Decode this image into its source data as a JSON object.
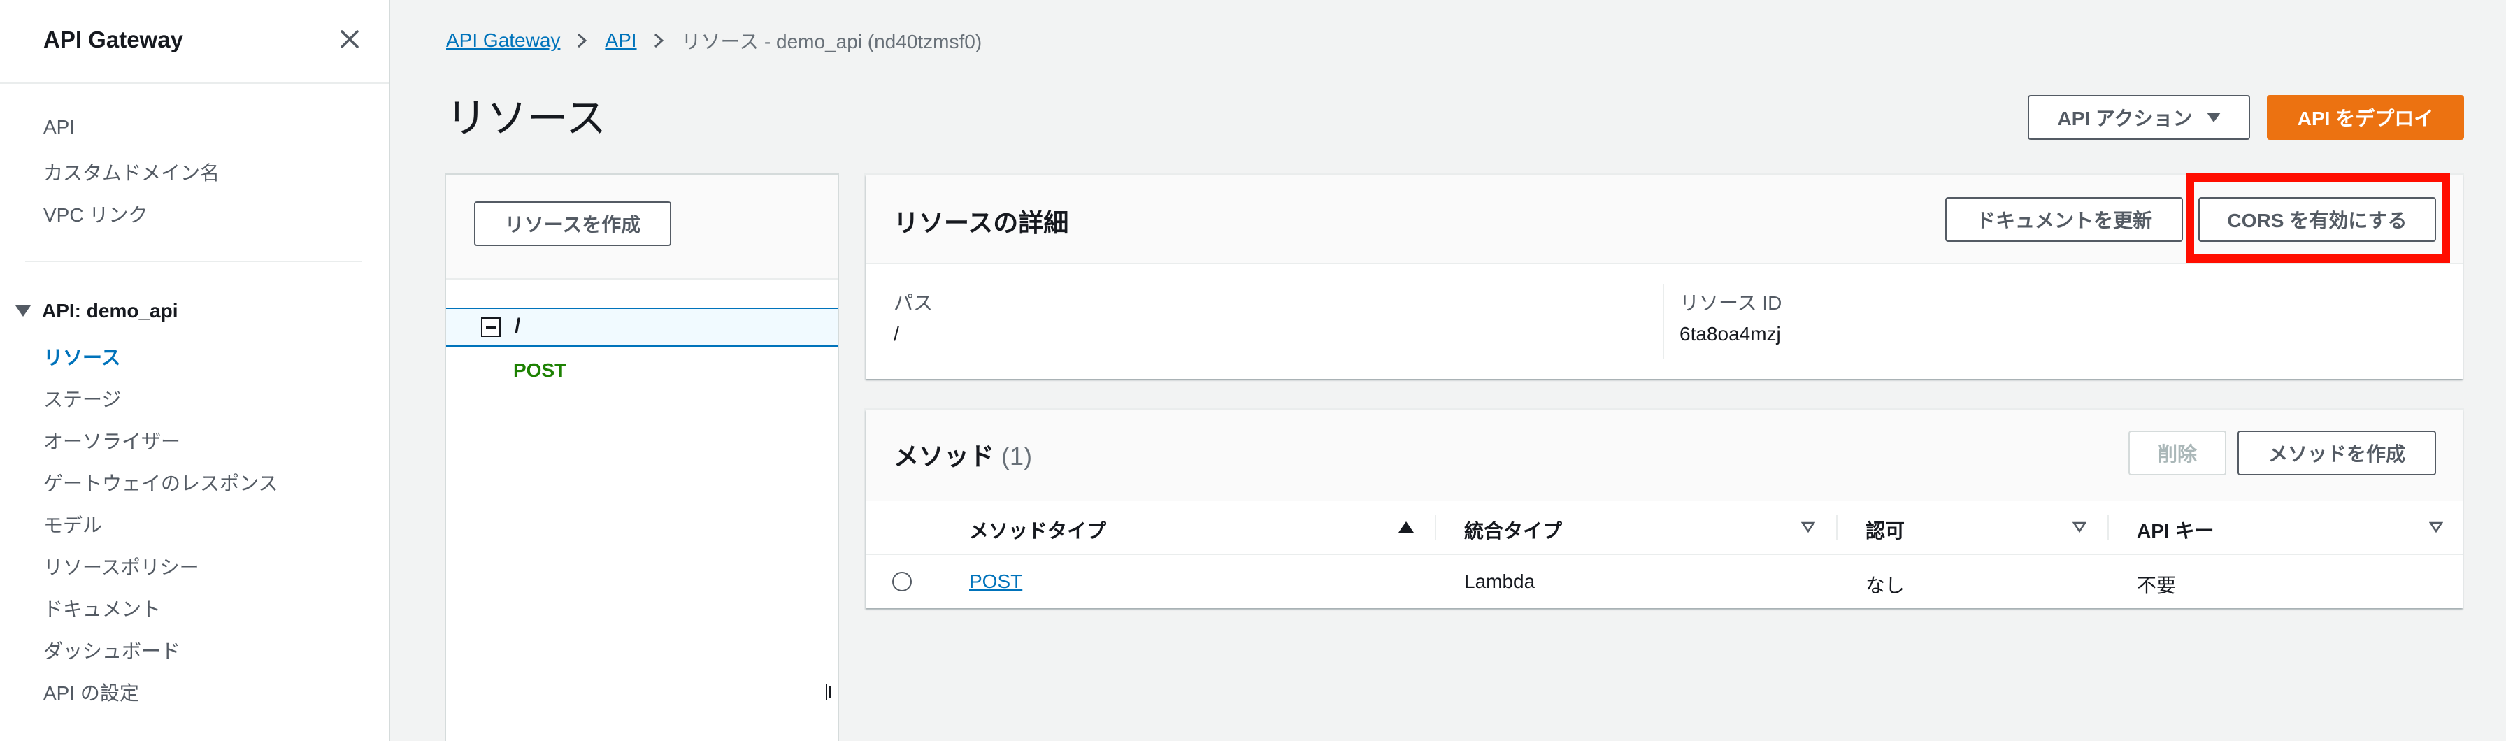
{
  "sidebar": {
    "title": "API Gateway",
    "top_links": [
      "API",
      "カスタムドメイン名",
      "VPC リンク"
    ],
    "section_title": "API: demo_api",
    "section_links": [
      "リソース",
      "ステージ",
      "オーソライザー",
      "ゲートウェイのレスポンス",
      "モデル",
      "リソースポリシー",
      "ドキュメント",
      "ダッシュボード",
      "API の設定"
    ],
    "active_link": "リソース"
  },
  "breadcrumb": {
    "items": [
      "API Gateway",
      "API"
    ],
    "current": "リソース - demo_api (nd40tzmsf0)"
  },
  "page": {
    "title": "リソース"
  },
  "actions": {
    "api_actions": "API アクション",
    "deploy": "API をデプロイ"
  },
  "tree": {
    "create_resource": "リソースを作成",
    "root": "/",
    "method": "POST"
  },
  "details": {
    "title": "リソースの詳細",
    "update_docs": "ドキュメントを更新",
    "enable_cors": "CORS を有効にする",
    "path_label": "パス",
    "path_value": "/",
    "id_label": "リソース ID",
    "id_value": "6ta8oa4mzj"
  },
  "methods": {
    "title": "メソッド",
    "count": "(1)",
    "delete": "削除",
    "create": "メソッドを作成",
    "columns": [
      "メソッドタイプ",
      "統合タイプ",
      "認可",
      "API キー"
    ],
    "rows": [
      {
        "method": "POST",
        "integration": "Lambda",
        "auth": "なし",
        "api_key": "不要"
      }
    ]
  },
  "colors": {
    "primary_button": "#ec7211",
    "link": "#0073bb",
    "method_post": "#1d8102",
    "highlight": "#ff0d00"
  }
}
